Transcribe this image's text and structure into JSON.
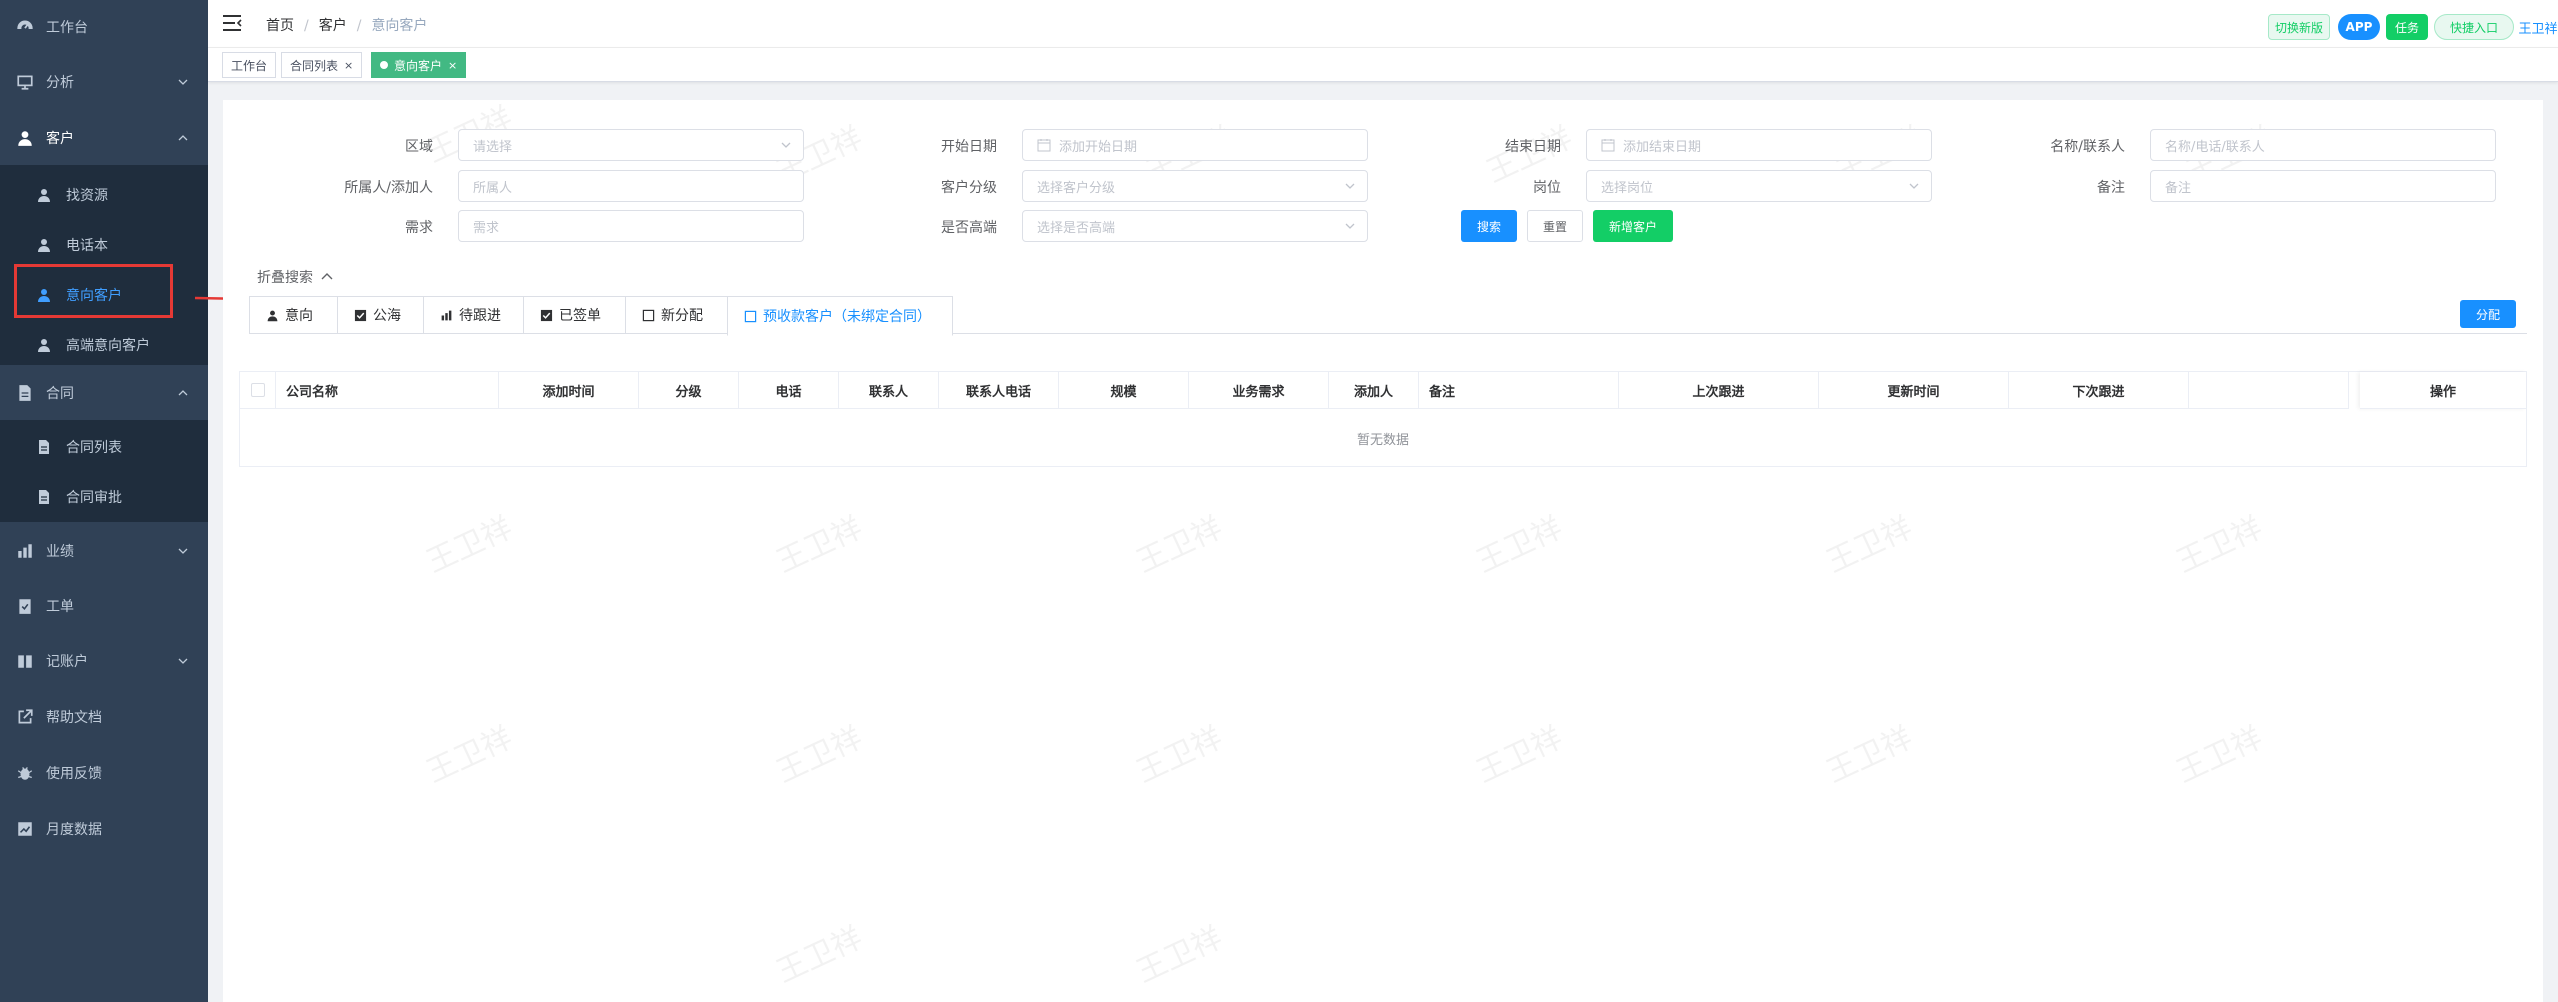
{
  "sidebar": {
    "items": [
      {
        "label": "工作台",
        "icon": "dashboard-icon"
      },
      {
        "label": "分析",
        "icon": "chart-icon",
        "expandable": true
      },
      {
        "label": "客户",
        "icon": "user-icon",
        "expanded": true
      },
      {
        "label": "合同",
        "icon": "document-icon",
        "expanded": true
      },
      {
        "label": "业绩",
        "icon": "bar-chart-icon",
        "expandable": true
      },
      {
        "label": "工单",
        "icon": "clipboard-icon"
      },
      {
        "label": "记账户",
        "icon": "book-icon",
        "expandable": true
      },
      {
        "label": "帮助文档",
        "icon": "external-link-icon"
      },
      {
        "label": "使用反馈",
        "icon": "bug-icon"
      },
      {
        "label": "月度数据",
        "icon": "chart-square-icon"
      }
    ],
    "customer_sub": [
      {
        "label": "找资源"
      },
      {
        "label": "电话本"
      },
      {
        "label": "意向客户",
        "active": true
      },
      {
        "label": "高端意向客户"
      }
    ],
    "contract_sub": [
      {
        "label": "合同列表"
      },
      {
        "label": "合同审批"
      }
    ]
  },
  "header": {
    "breadcrumb": [
      "首页",
      "客户",
      "意向客户"
    ],
    "buttons": {
      "switch_version": "切换新版",
      "app": "APP",
      "task": "任务",
      "quick_entry": "快捷入口",
      "username": "王卫祥"
    }
  },
  "tags": [
    {
      "label": "工作台"
    },
    {
      "label": "合同列表",
      "closable": true
    },
    {
      "label": "意向客户",
      "closable": true,
      "active": true
    }
  ],
  "filters": {
    "region": {
      "label": "区域",
      "placeholder": "请选择"
    },
    "start_date": {
      "label": "开始日期",
      "placeholder": "添加开始日期"
    },
    "end_date": {
      "label": "结束日期",
      "placeholder": "添加结束日期"
    },
    "name_contact": {
      "label": "名称/联系人",
      "placeholder": "名称/电话/联系人"
    },
    "owner": {
      "label": "所属人/添加人",
      "placeholder": "所属人"
    },
    "level": {
      "label": "客户分级",
      "placeholder": "选择客户分级"
    },
    "position": {
      "label": "岗位",
      "placeholder": "选择岗位"
    },
    "remark": {
      "label": "备注",
      "placeholder": "备注"
    },
    "demand": {
      "label": "需求",
      "placeholder": "需求"
    },
    "high_end": {
      "label": "是否高端",
      "placeholder": "选择是否高端"
    }
  },
  "actions": {
    "search": "搜索",
    "reset": "重置",
    "add_customer": "新增客户",
    "collapse": "折叠搜索",
    "assign": "分配"
  },
  "tabs": [
    {
      "label": "意向",
      "icon": "user-icon"
    },
    {
      "label": "公海",
      "icon": "check-square-icon"
    },
    {
      "label": "待跟进",
      "icon": "bar-chart-icon"
    },
    {
      "label": "已签单",
      "icon": "check-square-icon"
    },
    {
      "label": "新分配",
      "icon": "square-icon"
    },
    {
      "label": "预收款客户（未绑定合同）",
      "icon": "square-icon",
      "active": true
    }
  ],
  "table": {
    "columns": [
      "公司名称",
      "添加时间",
      "分级",
      "电话",
      "联系人",
      "联系人电话",
      "规模",
      "业务需求",
      "添加人",
      "备注",
      "上次跟进",
      "更新时间",
      "下次跟进",
      "",
      "操作"
    ],
    "empty_text": "暂无数据"
  },
  "watermark": "王卫祥",
  "colors": {
    "sidebar_bg": "#304156",
    "submenu_bg": "#1f2d3d",
    "primary": "#1890ff",
    "success": "#13ce66",
    "tag_active": "#42b983",
    "highlight": "#e53935"
  }
}
